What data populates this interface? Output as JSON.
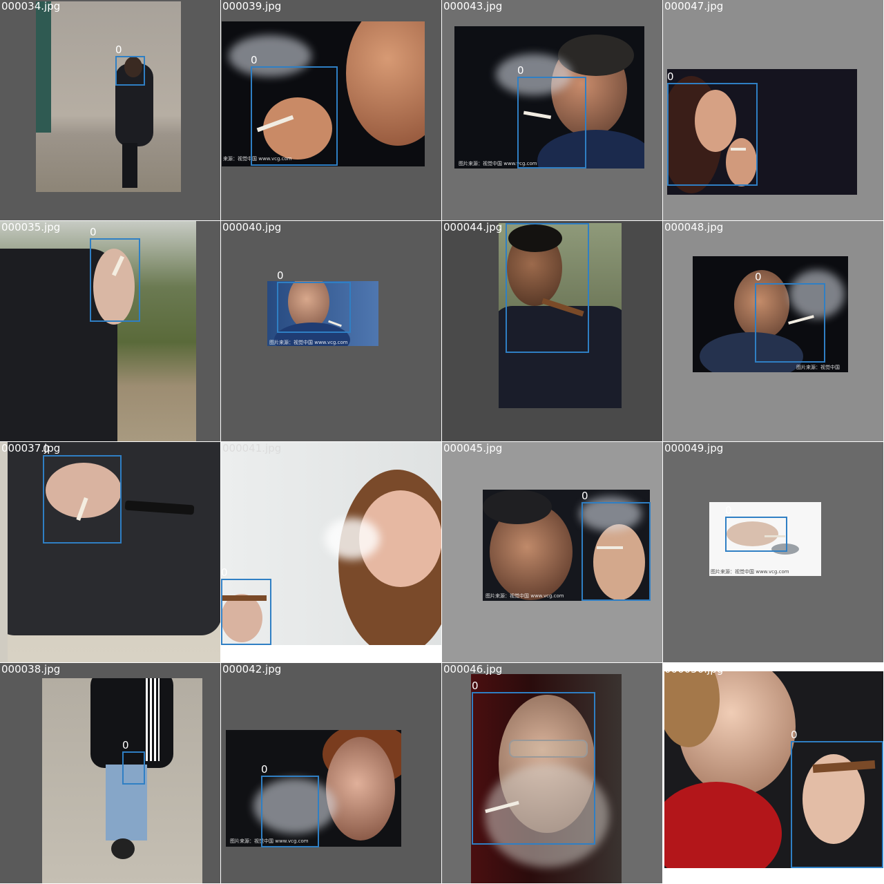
{
  "grid": {
    "columns": 4,
    "rows": 4,
    "box_color": "#2f7fc4",
    "box_label": "0"
  },
  "tiles": [
    {
      "file": "000034.jpg"
    },
    {
      "file": "000039.jpg",
      "watermark": "来源：视觉中国 www.vcg.com"
    },
    {
      "file": "000043.jpg",
      "watermark": "图片来源：视觉中国 www.vcg.com"
    },
    {
      "file": "000047.jpg"
    },
    {
      "file": "000035.jpg"
    },
    {
      "file": "000040.jpg",
      "watermark": "图片来源：视觉中国 www.vcg.com"
    },
    {
      "file": "000044.jpg"
    },
    {
      "file": "000048.jpg",
      "watermark": "图片来源：视觉中国"
    },
    {
      "file": "000037.jpg"
    },
    {
      "file": "000041.jpg"
    },
    {
      "file": "000045.jpg",
      "watermark": "图片来源：视觉中国 www.vcg.com"
    },
    {
      "file": "000049.jpg",
      "watermark": "图片来源：视觉中国 www.vcg.com"
    },
    {
      "file": "000038.jpg"
    },
    {
      "file": "000042.jpg",
      "watermark": "图片来源：视觉中国 www.vcg.com"
    },
    {
      "file": "000046.jpg"
    },
    {
      "file": "000050.jpg"
    }
  ]
}
